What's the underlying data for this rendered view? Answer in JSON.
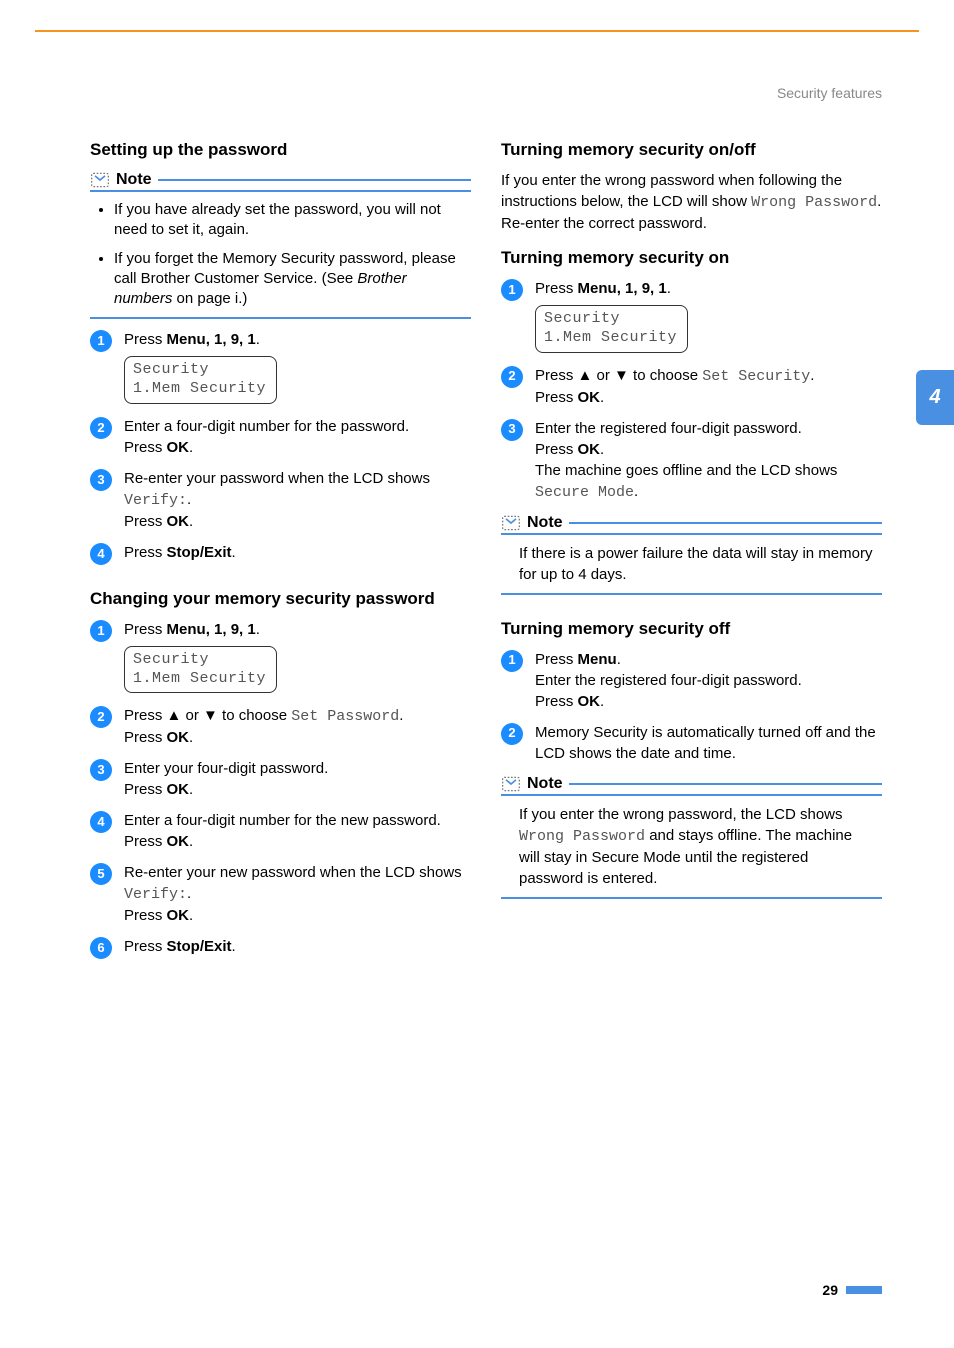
{
  "header": {
    "category": "Security features"
  },
  "chapter_tab": "4",
  "page_number": "29",
  "lcd": {
    "line1": "Security",
    "line2": "1.Mem Security"
  },
  "left": {
    "s1": {
      "title": "Setting up the password",
      "note_label": "Note",
      "note_items": [
        "If you have already set the password, you will not need to set it, again.",
        "If you forget the Memory Security password, please call Brother Customer Service. (See "
      ],
      "note_link_text": "Brother numbers",
      "note_after_link": " on page i.)",
      "steps": {
        "a_pre": "Press ",
        "a_keys": "Menu",
        "a_keys_rest": ", 1, 9, 1",
        "b": "Enter a four-digit number for the password.",
        "b_ok_pre": "Press ",
        "b_ok": "OK",
        "c_pre": "Re-enter your password when the LCD shows ",
        "c_mono": "Verify:",
        "c_post": ".",
        "c_ok_pre": "Press ",
        "c_ok": "OK",
        "d_pre": "Press ",
        "d_key": "Stop/Exit",
        "d_post": "."
      }
    },
    "s2": {
      "title": "Changing your memory security password",
      "steps": {
        "a_pre": "Press ",
        "a_keys": "Menu",
        "a_keys_rest": ", 1, 9, 1",
        "b_pre": "Press ▲ or ▼ to choose ",
        "b_mono": "Set Password",
        "b_post": ".",
        "b_ok_pre": "Press ",
        "b_ok": "OK",
        "c": "Enter your four-digit password.",
        "c_ok_pre": "Press ",
        "c_ok": "OK",
        "d": "Enter a four-digit number for the new password.",
        "d_ok_pre": "Press ",
        "d_ok": "OK",
        "e_pre": "Re-enter your new password when the LCD shows ",
        "e_mono": "Verify:",
        "e_post": ".",
        "e_ok_pre": "Press ",
        "e_ok": "OK",
        "f_pre": "Press ",
        "f_key": "Stop/Exit",
        "f_post": "."
      }
    }
  },
  "right": {
    "s1": {
      "title": "Turning memory security on/off",
      "intro_pre": "If you enter the wrong password when following the instructions below, the LCD will show ",
      "intro_mono": "Wrong Password",
      "intro_post": ". Re-enter the correct password."
    },
    "s2": {
      "title": "Turning memory security on",
      "steps": {
        "a_pre": "Press ",
        "a_keys": "Menu",
        "a_keys_rest": ", 1, 9, 1",
        "b_pre": "Press ▲ or ▼ to choose ",
        "b_mono": "Set Security",
        "b_post": ".",
        "b_ok_pre": "Press ",
        "b_ok": "OK",
        "c": "Enter the registered four-digit password.",
        "c_ok_pre": "Press ",
        "c_ok": "OK",
        "c2_pre": "The machine goes offline and the LCD shows ",
        "c2_mono": "Secure Mode",
        "c2_post": "."
      },
      "note_label": "Note",
      "note_text": "If there is a power failure the data will stay in memory for up to 4 days."
    },
    "s3": {
      "title": "Turning memory security off",
      "steps": {
        "a_pre": "Press ",
        "a_key": "Menu",
        "a_post": ".",
        "a2": "Enter the registered four-digit password.",
        "a_ok_pre": "Press ",
        "a_ok": "OK",
        "b": "Memory Security is automatically turned off and the LCD shows the date and time."
      },
      "note_label": "Note",
      "note_pre": "If you enter the wrong password, the LCD shows ",
      "note_mono": "Wrong Password",
      "note_post": " and stays offline. The machine will stay in Secure Mode until the registered password is entered."
    }
  }
}
